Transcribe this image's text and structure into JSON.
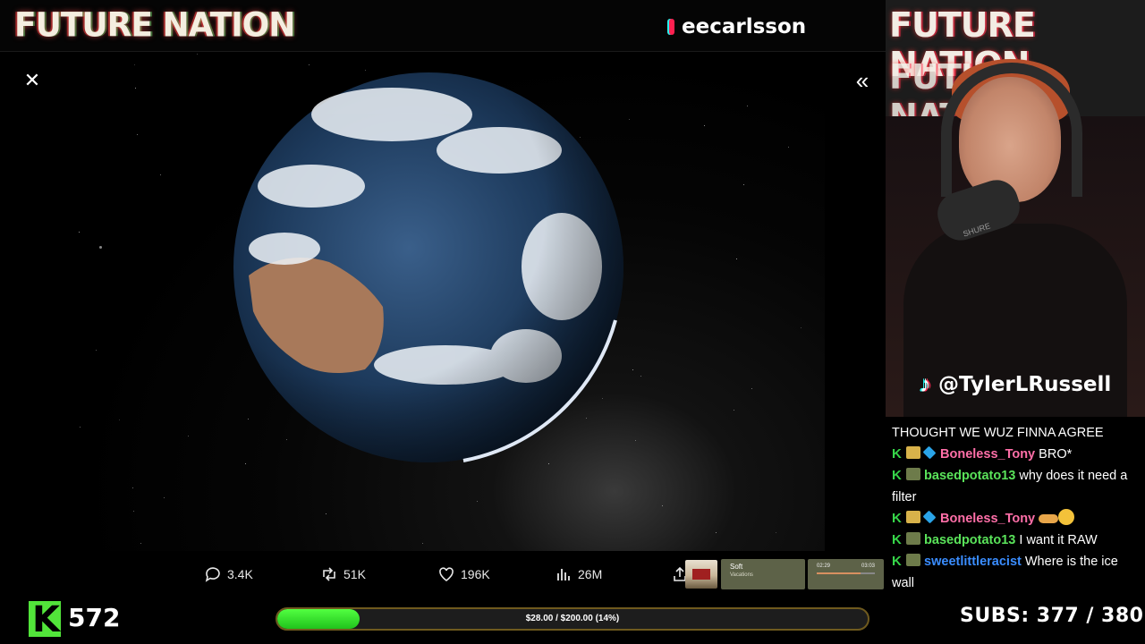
{
  "header": {
    "brand": "FUTURE NATION",
    "tiktok_handle": "eecarlsson"
  },
  "viewer": {
    "close_glyph": "✕",
    "expand_glyph": "«",
    "image_description_icon": "earth-from-space-image"
  },
  "tweet_actions": {
    "replies": "3.4K",
    "reposts": "51K",
    "likes": "196K",
    "views": "26M"
  },
  "music_player": {
    "track_title": "Soft",
    "track_subtitle": "Vacations",
    "elapsed": "02:29",
    "duration": "03:03",
    "progress": 0.75
  },
  "webcam": {
    "wall_text": "FUTURE NATION",
    "mic_brand": "SHURE",
    "tiktok_handle": "@TylerLRussell"
  },
  "chat": {
    "messages": [
      {
        "user": "",
        "text": "THOUGHT WE WUZ FINNA AGREE",
        "color": "#ffffff"
      },
      {
        "user": "Boneless_Tony",
        "text": "BRO*",
        "color": "#ff6fa8",
        "badges": [
          "gold",
          "gem"
        ]
      },
      {
        "user": "basedpotato13",
        "text": "why does it need a filter",
        "color": "#5ae35a",
        "badges": [
          "camo"
        ]
      },
      {
        "user": "Boneless_Tony",
        "text": "",
        "color": "#ff6fa8",
        "badges": [
          "gold",
          "gem"
        ]
      },
      {
        "user": "basedpotato13",
        "text": "I want it RAW",
        "color": "#5ae35a",
        "badges": [
          "camo"
        ]
      },
      {
        "user": "sweetlittleracist",
        "text": "Where is the ice wall",
        "color": "#3a8dff",
        "badges": [
          "camo"
        ]
      }
    ]
  },
  "footer": {
    "viewers": "572",
    "goal_text": "$28.00 / $200.00 (14%)",
    "goal_fraction": 0.14,
    "subs": "SUBS:  377 / 380"
  },
  "colors": {
    "kick_green": "#52e53a",
    "goal_border": "#6f5a1e"
  }
}
